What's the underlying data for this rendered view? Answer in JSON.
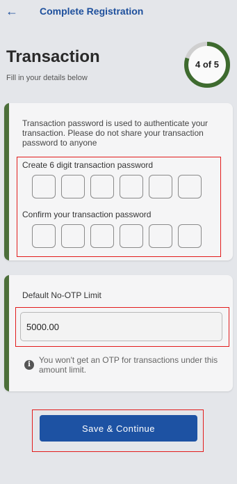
{
  "header": {
    "back_icon": "back-arrow-icon",
    "title": "Complete Registration"
  },
  "page": {
    "title": "Transaction",
    "subtitle": "Fill in your details below"
  },
  "progress": {
    "label": "4 of 5",
    "current": 4,
    "total": 5,
    "ring_color": "#3e6b2f",
    "track_color": "#cfcfcf"
  },
  "transaction_card": {
    "info": "Transaction password is used to authenticate your transaction. Please do not share your transaction password to anyone",
    "create_label": "Create 6 digit transaction password",
    "confirm_label": "Confirm your transaction password",
    "pin_length": 6
  },
  "limit_card": {
    "label": "Default No-OTP Limit",
    "value": "5000.00",
    "info_icon": "info-circle-icon",
    "note": "You won't get an OTP for transactions under this amount limit."
  },
  "actions": {
    "save_label": "Save & Continue"
  },
  "colors": {
    "accent_green": "#4c6f3a",
    "primary_blue": "#1d52a3",
    "highlight_red": "#e21b1b"
  }
}
